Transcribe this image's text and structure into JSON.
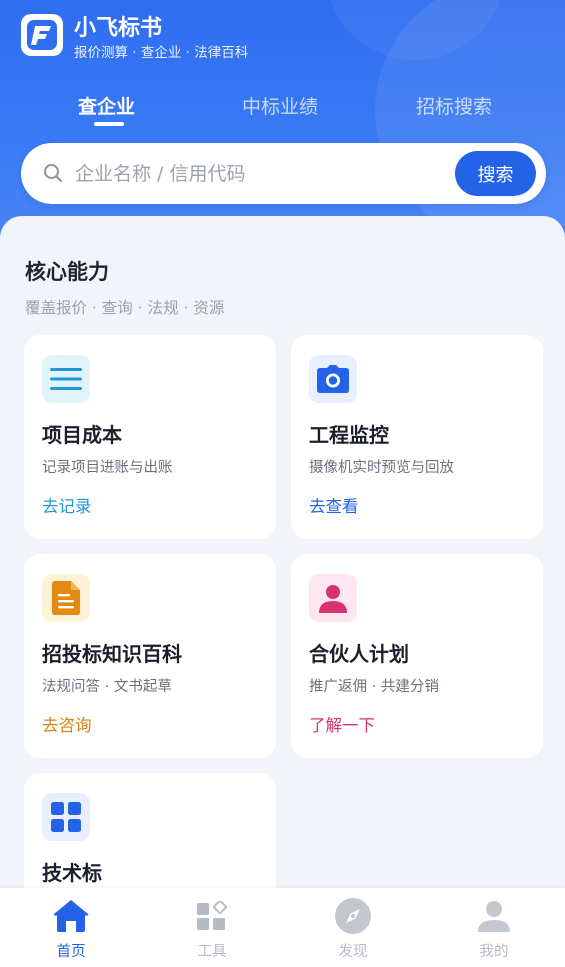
{
  "header": {
    "app_title": "小飞标书",
    "app_subtitle": "报价测算 · 查企业 · 法律百科",
    "tabs": [
      {
        "label": "查企业",
        "active": true
      },
      {
        "label": "中标业绩",
        "active": false
      },
      {
        "label": "招标搜索",
        "active": false
      }
    ]
  },
  "search": {
    "placeholder": "企业名称 / 信用代码",
    "value": "",
    "button_label": "搜索"
  },
  "section": {
    "title": "核心能力",
    "subtitle": "覆盖报价 · 查询 · 法规 · 资源"
  },
  "cards": [
    {
      "title": "项目成本",
      "desc": "记录项目进账与出账",
      "link": "去记录",
      "icon": "list-icon",
      "link_color": "#1f9ad6",
      "icon_bg": "#e2f3fb"
    },
    {
      "title": "工程监控",
      "desc": "摄像机实时预览与回放",
      "link": "去查看",
      "icon": "camera-icon",
      "link_color": "#2463e8",
      "icon_bg": "#e8efff"
    },
    {
      "title": "招投标知识百科",
      "desc": "法规问答 · 文书起草",
      "link": "去咨询",
      "icon": "document-icon",
      "link_color": "#d9820f",
      "icon_bg": "#fdf1d6"
    },
    {
      "title": "合伙人计划",
      "desc": "推广返佣 · 共建分销",
      "link": "了解一下",
      "icon": "person-icon",
      "link_color": "#d9336f",
      "icon_bg": "#fde6ef"
    },
    {
      "title": "技术标",
      "desc": "",
      "link": "",
      "icon": "grid-icon",
      "link_color": "#2463e8",
      "icon_bg": "#e8efff"
    }
  ],
  "bottom_nav": [
    {
      "label": "首页",
      "icon": "home-icon",
      "active": true
    },
    {
      "label": "工具",
      "icon": "tools-icon",
      "active": false
    },
    {
      "label": "发现",
      "icon": "compass-icon",
      "active": false
    },
    {
      "label": "我的",
      "icon": "user-icon",
      "active": false
    }
  ],
  "colors": {
    "primary": "#2463e8",
    "header_gradient_top": "#2f6df0",
    "header_gradient_bottom": "#4a86f7",
    "background": "#f1f4f9"
  }
}
